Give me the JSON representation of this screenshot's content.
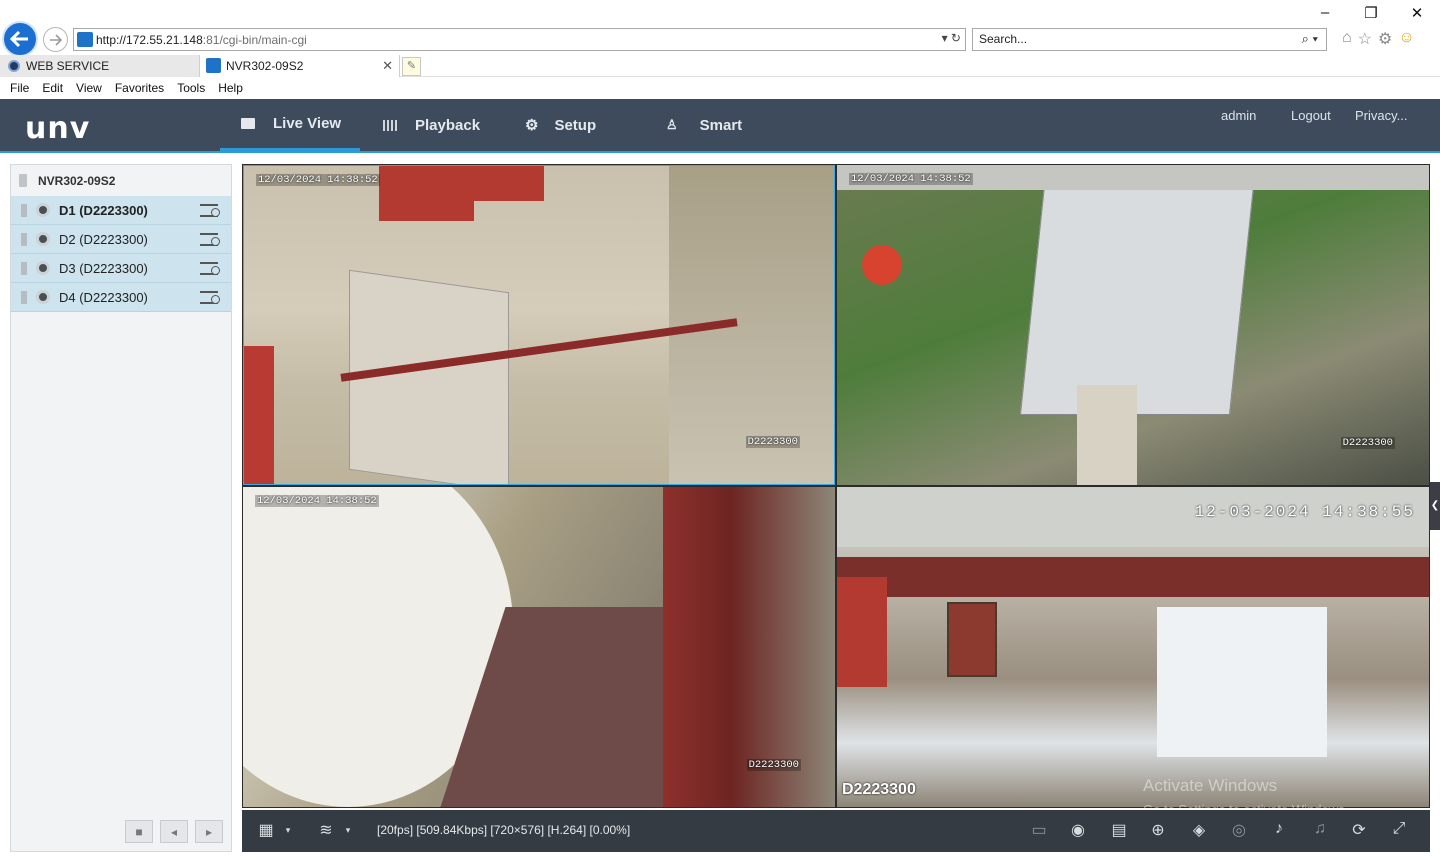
{
  "browser": {
    "url_main": "http://172.55.21.148",
    "url_rest": ":81/cgi-bin/main-cgi",
    "search_placeholder": "Search...",
    "tabs": [
      {
        "label": "WEB SERVICE"
      },
      {
        "label": "NVR302-09S2"
      }
    ],
    "menu": [
      "File",
      "Edit",
      "View",
      "Favorites",
      "Tools",
      "Help"
    ]
  },
  "app": {
    "logo": "unv",
    "nav": [
      {
        "label": "Live View",
        "icon": "monitor-icon",
        "active": true
      },
      {
        "label": "Playback",
        "icon": "film-icon",
        "active": false
      },
      {
        "label": "Setup",
        "icon": "gear-icon",
        "active": false
      },
      {
        "label": "Smart",
        "icon": "person-icon",
        "active": false
      }
    ],
    "user": "admin",
    "logout": "Logout",
    "privacy": "Privacy..."
  },
  "sidebar": {
    "device": "NVR302-09S2",
    "channels": [
      {
        "label": "D1 (D2223300)",
        "active": true
      },
      {
        "label": "D2 (D2223300)",
        "active": false
      },
      {
        "label": "D3 (D2223300)",
        "active": false
      },
      {
        "label": "D4 (D2223300)",
        "active": false
      }
    ]
  },
  "tiles": [
    {
      "timestamp": "12/03/2024 14:38:52",
      "channel_id": "D2223300"
    },
    {
      "timestamp": "12/03/2024 14:38:52",
      "channel_id": "D2223300"
    },
    {
      "timestamp": "12/03/2024 14:38:52",
      "channel_id": "D2223300"
    },
    {
      "timestamp": "12-03-2024 14:38:55",
      "channel_id": "D2223300"
    }
  ],
  "toolbar": {
    "status": "[20fps] [509.84Kbps] [720×576] [H.264] [0.00%]"
  },
  "watermark": {
    "line1": "Activate Windows",
    "line2": "Go to Settings to activate Windows."
  }
}
